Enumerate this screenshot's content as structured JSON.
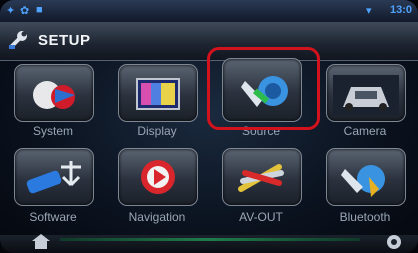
{
  "header": {
    "title": "SETUP"
  },
  "menu": {
    "items": [
      {
        "label": "System",
        "icon": "system-icon"
      },
      {
        "label": "Display",
        "icon": "display-icon"
      },
      {
        "label": "Source",
        "icon": "source-icon",
        "selected": true
      },
      {
        "label": "Camera",
        "icon": "camera-icon"
      },
      {
        "label": "Software",
        "icon": "software-icon"
      },
      {
        "label": "Navigation",
        "icon": "navigation-icon"
      },
      {
        "label": "AV-OUT",
        "icon": "av-out-icon"
      },
      {
        "label": "Bluetooth",
        "icon": "bluetooth-icon"
      }
    ]
  },
  "colors": {
    "highlight": "#d2121c",
    "accent": "#4fa3ff"
  }
}
